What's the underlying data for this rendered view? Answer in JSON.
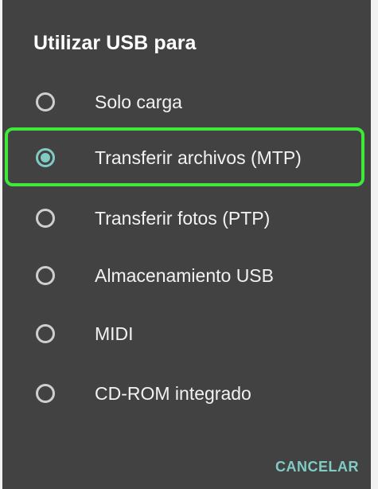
{
  "dialog": {
    "title": "Utilizar USB para",
    "options": [
      {
        "label": "Solo carga",
        "selected": false
      },
      {
        "label": "Transferir archivos (MTP)",
        "selected": true
      },
      {
        "label": "Transferir fotos (PTP)",
        "selected": false
      },
      {
        "label": "Almacenamiento USB",
        "selected": false
      },
      {
        "label": "MIDI",
        "selected": false
      },
      {
        "label": "CD-ROM integrado",
        "selected": false
      }
    ],
    "cancel_label": "CANCELAR"
  },
  "colors": {
    "background": "#424242",
    "accent": "#80cbc4",
    "highlight": "#3ee93a",
    "text": "#f2f2f2"
  }
}
